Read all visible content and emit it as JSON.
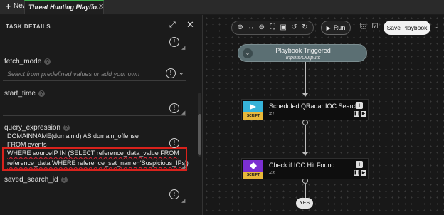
{
  "tabbar": {
    "new_label": "New",
    "active_tab": "Threat Hunting Playbo...",
    "dirty_marker": "*"
  },
  "panel": {
    "title": "TASK DETAILS",
    "fields": {
      "top_box": {},
      "fetch_mode": {
        "label": "fetch_mode",
        "placeholder": "Select from predefined values or add your own"
      },
      "start_time": {
        "label": "start_time"
      },
      "query_expression": {
        "label": "query_expression",
        "lines": [
          "DOMAINNAME(domainid) AS domain_offense",
          "FROM events",
          "WHERE sourceIP IN (SELECT reference_data_value FROM",
          "reference_data WHERE reference_set_name='Suspicious_IPs')"
        ]
      },
      "saved_search_id": {
        "label": "saved_search_id"
      }
    }
  },
  "toolbar": {
    "run_label": "Run",
    "save_label": "Save Playbook"
  },
  "canvas": {
    "trigger": {
      "title": "Playbook Triggered",
      "subtitle": "Inputs/Outputs"
    },
    "nodes": [
      {
        "title": "Scheduled QRadar IOC Search",
        "number": "#1",
        "badge": "SCRIPT",
        "color": "#36b3d9"
      },
      {
        "title": "Check if IOC Hit Found",
        "number": "#3",
        "badge": "SCRIPT",
        "color": "#7b2fd1"
      }
    ],
    "yes_label": "YES"
  }
}
